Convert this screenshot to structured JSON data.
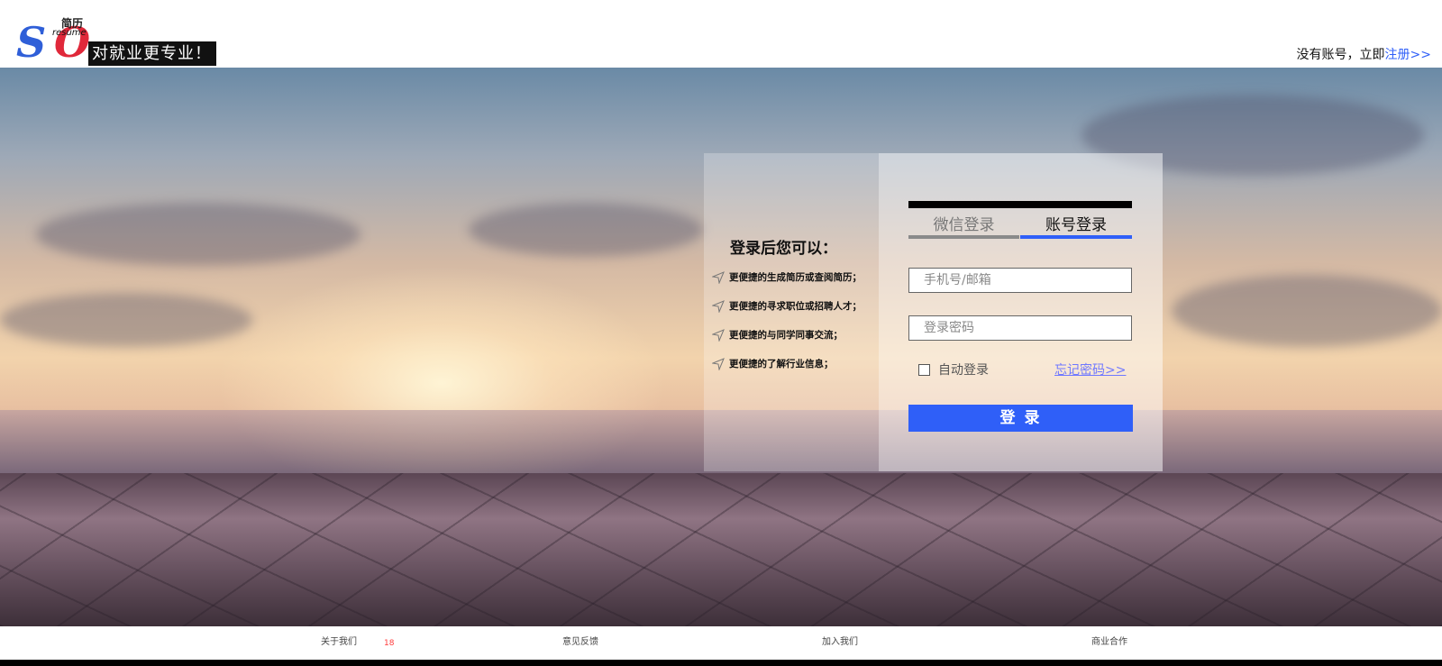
{
  "header": {
    "logo": {
      "letter_s": "S",
      "letter_o": "O",
      "small_cn": "简历",
      "small_en": "resume",
      "slogan": "对就业更专业！"
    },
    "register_prompt": "没有账号，立即",
    "register_link": "注册>>"
  },
  "benefits": {
    "title": "登录后您可以：",
    "items": [
      "更便捷的生成简历或查阅简历；",
      "更便捷的寻求职位或招聘人才；",
      "更便捷的与同学同事交流；",
      "更便捷的了解行业信息；"
    ],
    "icon": "send-arrow-icon"
  },
  "login": {
    "tabs": [
      {
        "label": "微信登录",
        "active": false
      },
      {
        "label": "账号登录",
        "active": true
      }
    ],
    "username_placeholder": "手机号/邮箱",
    "password_placeholder": "登录密码",
    "remember_label": "自动登录",
    "forgot_label": "忘记密码>>",
    "submit_label": "登 录"
  },
  "footer": {
    "links": [
      "关于我们",
      "意见反馈",
      "加入我们",
      "商业合作"
    ],
    "count": "18"
  },
  "colors": {
    "accent": "#2f5ff8",
    "forgot": "#6f78ff",
    "footer_count": "#ff3b3b"
  }
}
